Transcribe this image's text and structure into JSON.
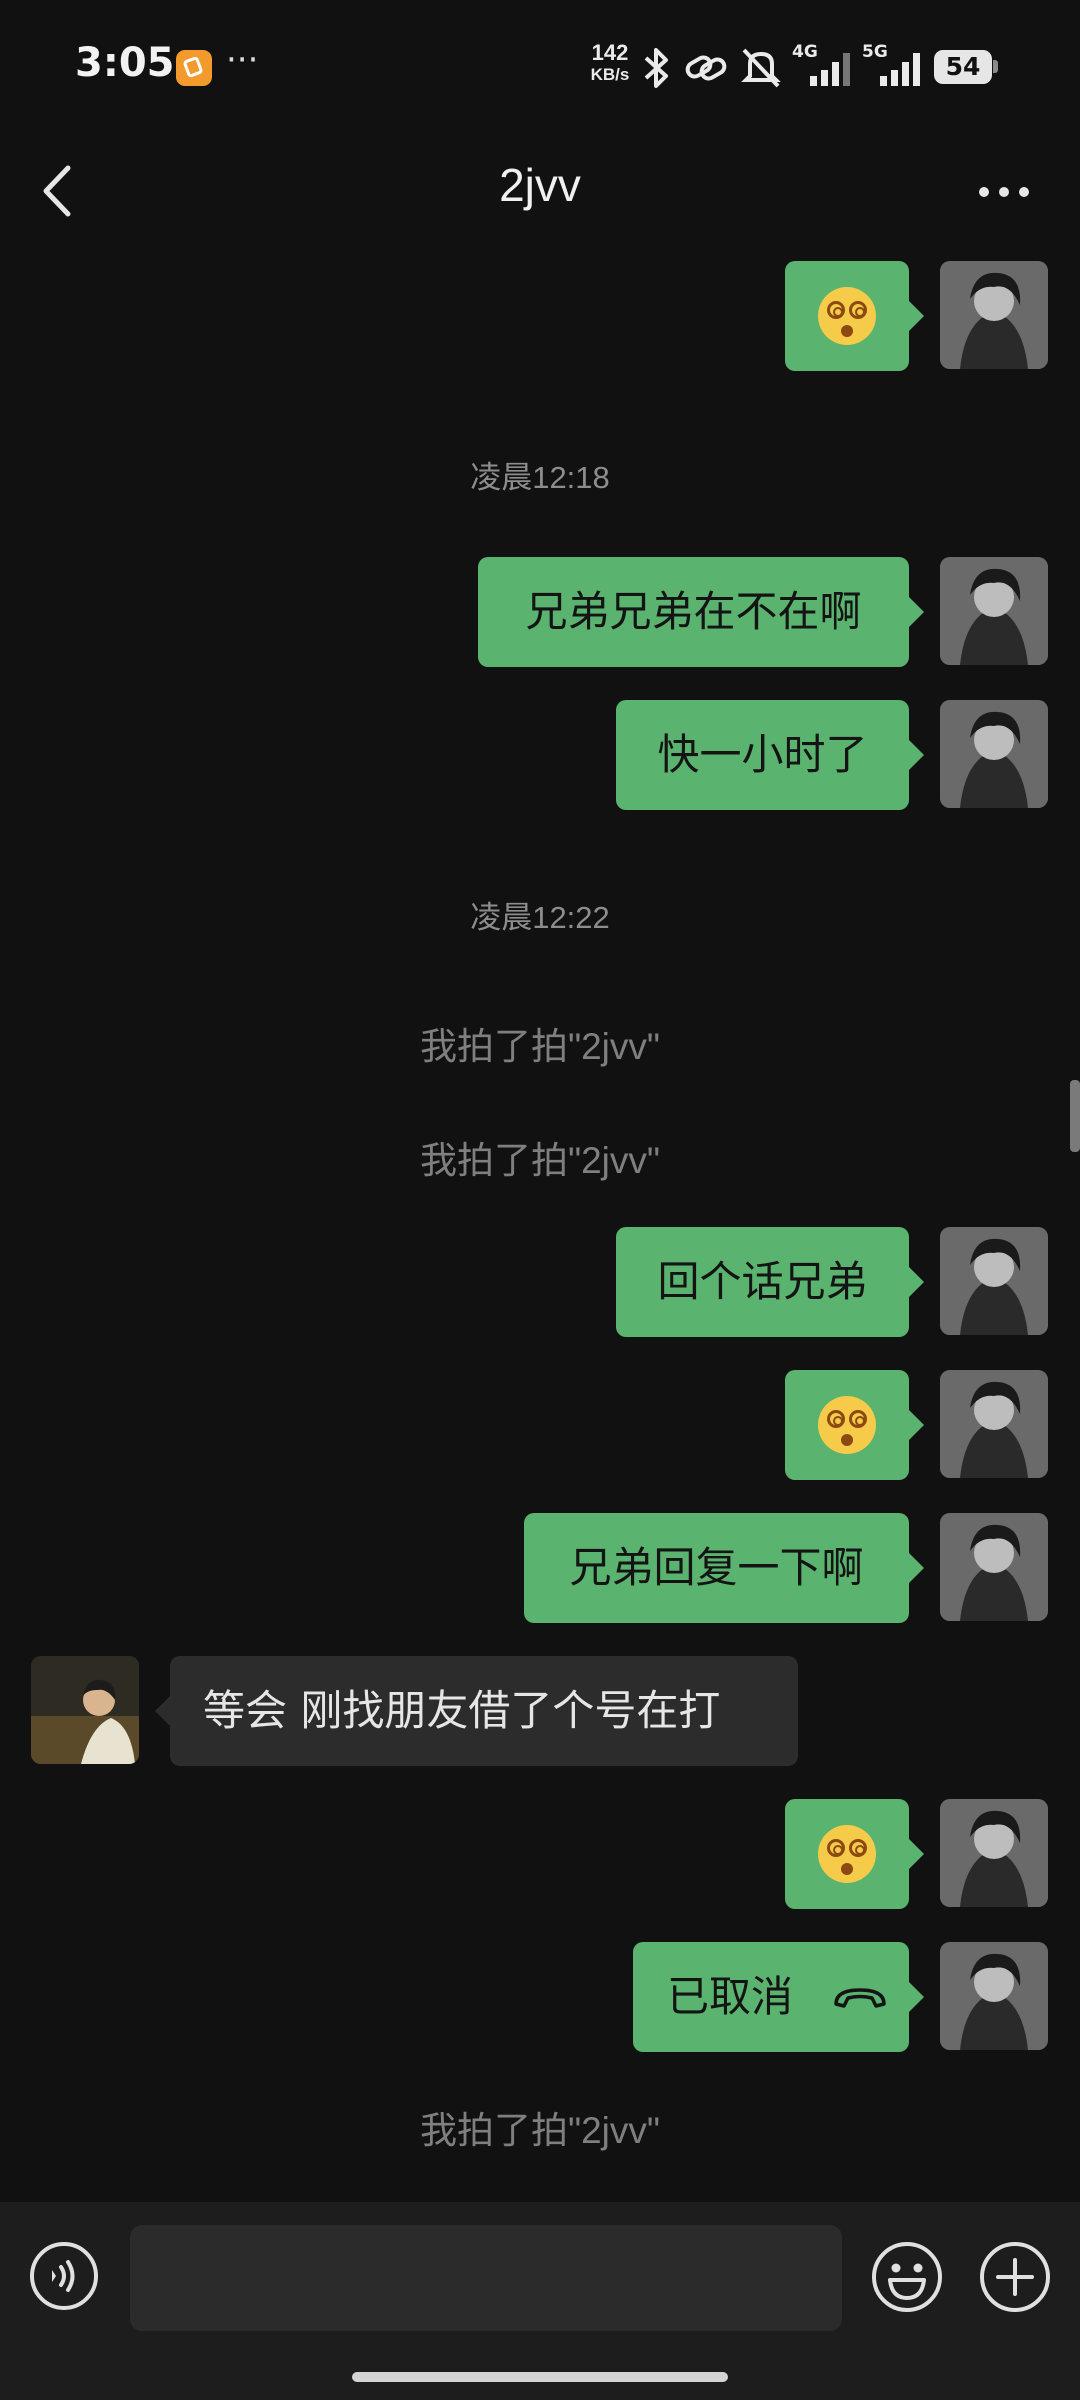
{
  "status_bar": {
    "time": "3:05",
    "more_indicator": "···",
    "net_speed_value": "142",
    "net_speed_unit": "KB/s",
    "signal_1_label": "4G",
    "signal_2_label": "5G",
    "battery": "54",
    "icons": [
      "app-notification-icon",
      "bluetooth-icon",
      "link-icon",
      "mute-icon",
      "signal-icon",
      "battery-icon"
    ]
  },
  "header": {
    "title": "2jvv",
    "back_icon": "chevron-left-icon",
    "more_icon": "more-horizontal-icon"
  },
  "messages": {
    "m1_emoji": "dizzy-face",
    "ts1": "凌晨12:18",
    "m2": "兄弟兄弟在不在啊",
    "m3": "快一小时了",
    "ts2": "凌晨12:22",
    "sys1": "我拍了拍\"2jvv\"",
    "sys2": "我拍了拍\"2jvv\"",
    "m4": "回个话兄弟",
    "m5_emoji": "dizzy-face",
    "m6": "兄弟回复一下啊",
    "in1": "等会 刚找朋友借了个号在打",
    "m7_emoji": "dizzy-face",
    "m8": "已取消",
    "m8_icon": "hangup-icon",
    "sys3": "我拍了拍\"2jvv\""
  },
  "input_bar": {
    "placeholder": "",
    "voice_icon": "voice-icon",
    "emoji_icon": "smiley-icon",
    "plus_icon": "plus-icon"
  },
  "colors": {
    "background": "#111111",
    "outgoing_bubble": "#5ab470",
    "incoming_bubble": "#2c2c2c",
    "input_bar": "#1d1d1d"
  }
}
